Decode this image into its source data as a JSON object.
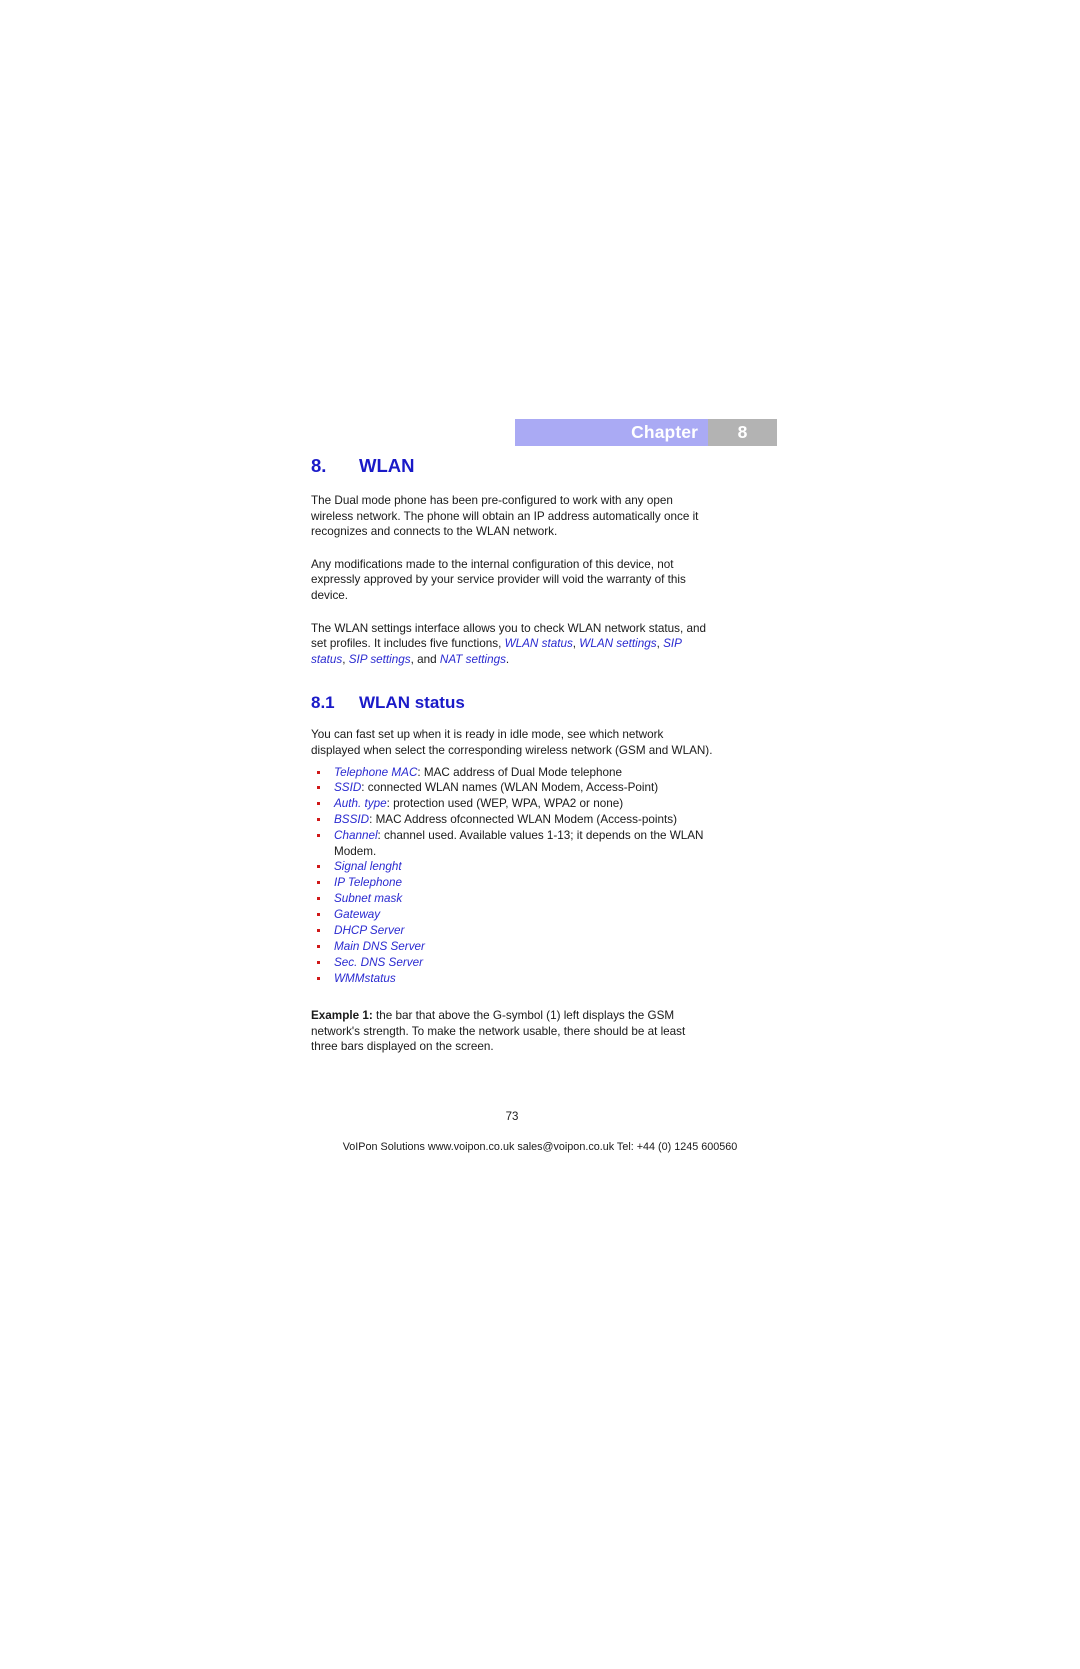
{
  "header": {
    "chapter_label": "Chapter",
    "chapter_number": "8",
    "bar_color": "#aaaaf4",
    "number_box_color": "#b3b3b3"
  },
  "section": {
    "number": "8.",
    "title": "WLAN",
    "heading_color": "#1a1ac8"
  },
  "paragraphs": {
    "p1": "The Dual mode phone has been pre-configured to work with any open wireless network. The phone will obtain an IP address automatically once it recognizes and connects to the WLAN network.",
    "p2": "Any modifications made to the internal configuration of this device, not expressly approved by your service provider will void the warranty of this device.",
    "p3_lead": "The WLAN settings interface allows you to check WLAN network status, and set profiles. It includes five functions, ",
    "p3_fn1": "WLAN status",
    "p3_sep1": ", ",
    "p3_fn2": "WLAN settings",
    "p3_sep2": ", ",
    "p3_fn3": "SIP status",
    "p3_sep3": ", ",
    "p3_fn4": "SIP settings",
    "p3_sep4": ", and ",
    "p3_fn5": "NAT settings",
    "p3_end": "."
  },
  "subsection": {
    "number": "8.1",
    "title": "WLAN status",
    "intro": "You can fast set up when it is ready in idle mode, see which network displayed when select the corresponding wireless network (GSM and WLAN)."
  },
  "bullets": [
    {
      "term": "Telephone MAC",
      "desc": ": MAC address of Dual Mode telephone",
      "italic_all": false
    },
    {
      "term": "SSID",
      "desc": ": connected WLAN names (WLAN Modem, Access-Point)",
      "italic_all": false
    },
    {
      "term": "Auth. type",
      "desc": ": protection used (WEP, WPA, WPA2 or none)",
      "italic_all": false
    },
    {
      "term": "BSSID",
      "desc": ": MAC Address ofconnected WLAN Modem (Access-points)",
      "italic_all": false
    },
    {
      "term": "Channel",
      "desc": ": channel used. Available values 1-13; it depends on the WLAN Modem.",
      "italic_all": false
    },
    {
      "term": "Signal lenght",
      "desc": "",
      "italic_all": true
    },
    {
      "term": "IP Telephone",
      "desc": "",
      "italic_all": true
    },
    {
      "term": "Subnet mask",
      "desc": "",
      "italic_all": true
    },
    {
      "term": "Gateway",
      "desc": "",
      "italic_all": true
    },
    {
      "term": "DHCP Server",
      "desc": "",
      "italic_all": true
    },
    {
      "term": "Main DNS Server",
      "desc": "",
      "italic_all": true
    },
    {
      "term": "Sec. DNS Server",
      "desc": "",
      "italic_all": true
    },
    {
      "term": "WMMstatus",
      "desc": "",
      "italic_all": true
    }
  ],
  "example": {
    "lead": "Example 1:",
    "text": " the bar that above the G-symbol (1) left displays the GSM network's strength. To make the network usable, there should be at least three bars displayed on the screen."
  },
  "page_number": "73",
  "footer": "VoIPon Solutions  www.voipon.co.uk  sales@voipon.co.uk  Tel: +44 (0) 1245 600560"
}
